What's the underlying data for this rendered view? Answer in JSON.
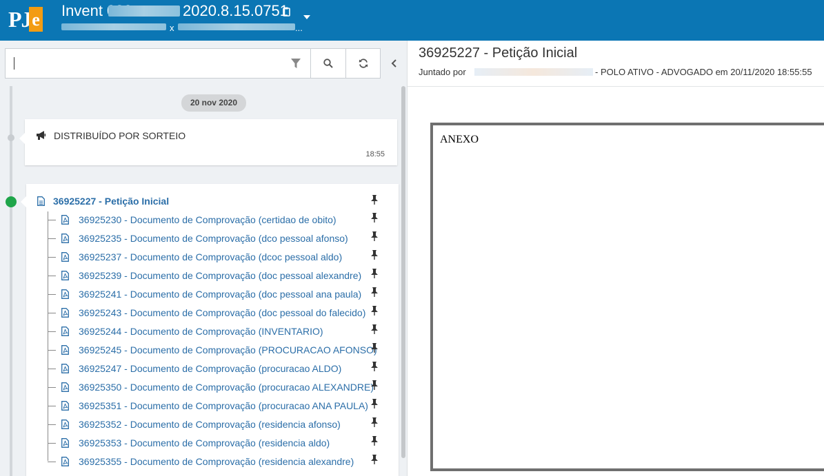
{
  "header": {
    "title_prefix": "Invent 080",
    "title_suffix": "2020.8.15.0751",
    "subtitle_x": "x",
    "subtitle_ellipsis": "...",
    "logo_text": "PJ",
    "logo_accent": "e"
  },
  "search": {
    "placeholder": ""
  },
  "timeline": {
    "date_label": "20 nov 2020",
    "event": {
      "label": "DISTRIBUÍDO POR SORTEIO",
      "time": "18:55"
    },
    "main_document": {
      "label": "36925227 - Petição Inicial"
    },
    "attachments": [
      {
        "label": "36925230 - Documento de Comprovação (certidao de obito)"
      },
      {
        "label": "36925235 - Documento de Comprovação (dco pessoal afonso)"
      },
      {
        "label": "36925237 - Documento de Comprovação (dcoc pessoal aldo)"
      },
      {
        "label": "36925239 - Documento de Comprovação (doc pessoal alexandre)"
      },
      {
        "label": "36925241 - Documento de Comprovação (doc pessoal ana paula)"
      },
      {
        "label": "36925243 - Documento de Comprovação (doc pessoal do falecido)"
      },
      {
        "label": "36925244 - Documento de Comprovação (INVENTARIO)"
      },
      {
        "label": "36925245 - Documento de Comprovação (PROCURACAO AFONSO)"
      },
      {
        "label": "36925247 - Documento de Comprovação (procuracao ALDO)"
      },
      {
        "label": "36925350 - Documento de Comprovação (procuracao ALEXANDRE)"
      },
      {
        "label": "36925351 - Documento de Comprovação (procuracao ANA PAULA)"
      },
      {
        "label": "36925352 - Documento de Comprovação (residencia afonso)"
      },
      {
        "label": "36925353 - Documento de Comprovação (residencia aldo)"
      },
      {
        "label": "36925355 - Documento de Comprovação (residencia alexandre)"
      }
    ]
  },
  "document_view": {
    "title": "36925227 - Petição Inicial",
    "juntado_prefix": "Juntado por",
    "juntado_suffix": "- POLO ATIVO - ADVOGADO em 20/11/2020 18:55:55",
    "content_text": "ANEXO"
  },
  "colors": {
    "header_bg": "#0b76b4",
    "link": "#2b6ea8",
    "active_dot": "#1fa54a",
    "logo_accent": "#f39c12"
  },
  "icons": {
    "copy": "copy-icon",
    "caret": "caret-down-icon",
    "filter": "filter-icon",
    "search": "search-icon",
    "refresh": "refresh-icon",
    "collapse": "chevron-left-icon",
    "event": "megaphone-icon",
    "document": "file-text-icon",
    "attachment": "file-pdf-icon",
    "pin": "pin-icon"
  }
}
